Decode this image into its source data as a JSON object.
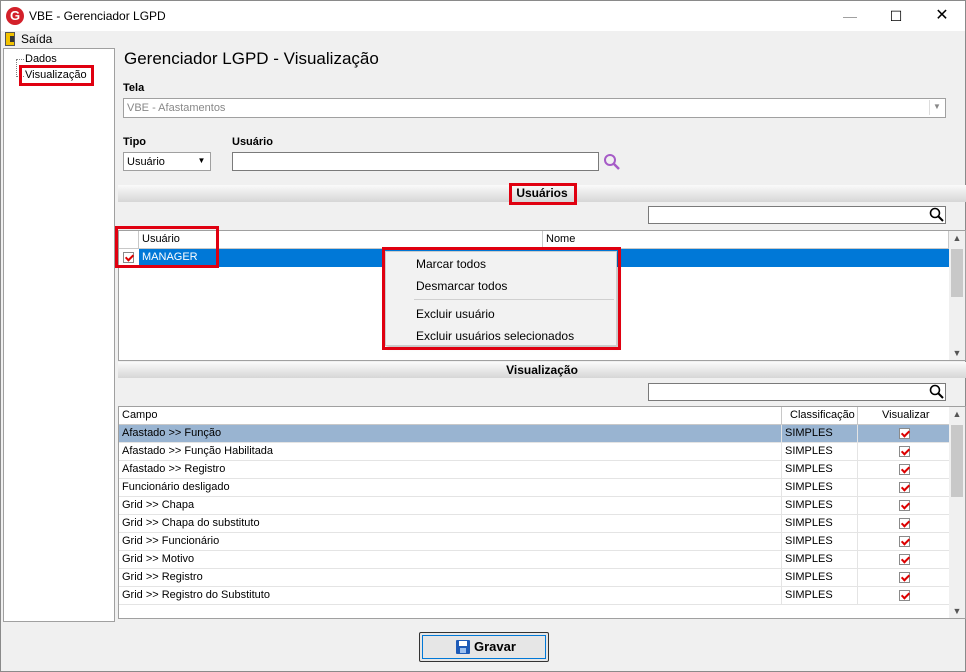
{
  "window": {
    "title": "VBE - Gerenciador LGPD",
    "icon_letter": "G",
    "minimize": "—",
    "maximize": "☐",
    "close": "✕"
  },
  "menu": {
    "exit_label": "Saída"
  },
  "tree": {
    "items": [
      {
        "label": "Dados"
      },
      {
        "label": "Visualização"
      }
    ]
  },
  "page": {
    "title": "Gerenciador LGPD - Visualização"
  },
  "form": {
    "tela_label": "Tela",
    "tela_value": "VBE - Afastamentos",
    "tipo_label": "Tipo",
    "tipo_value": "Usuário",
    "usuario_label": "Usuário",
    "usuario_value": ""
  },
  "users_section": {
    "title": "Usuários",
    "search_value": "",
    "columns": [
      "Usuário",
      "Nome"
    ],
    "rows": [
      {
        "usuario": "MANAGER",
        "nome": "",
        "checked": true
      }
    ]
  },
  "context_menu": {
    "items": [
      "Marcar todos",
      "Desmarcar todos",
      "Excluir usuário",
      "Excluir usuários selecionados"
    ]
  },
  "view_section": {
    "title": "Visualização",
    "search_value": "",
    "columns": [
      "Campo",
      "Classificação",
      "Visualizar"
    ],
    "rows": [
      {
        "campo": "Afastado >> Função",
        "classificacao": "SIMPLES",
        "visualizar": true
      },
      {
        "campo": "Afastado >> Função Habilitada",
        "classificacao": "SIMPLES",
        "visualizar": true
      },
      {
        "campo": "Afastado >> Registro",
        "classificacao": "SIMPLES",
        "visualizar": true
      },
      {
        "campo": "Funcionário desligado",
        "classificacao": "SIMPLES",
        "visualizar": true
      },
      {
        "campo": "Grid >> Chapa",
        "classificacao": "SIMPLES",
        "visualizar": true
      },
      {
        "campo": "Grid >> Chapa do substituto",
        "classificacao": "SIMPLES",
        "visualizar": true
      },
      {
        "campo": "Grid >> Funcionário",
        "classificacao": "SIMPLES",
        "visualizar": true
      },
      {
        "campo": "Grid >> Motivo",
        "classificacao": "SIMPLES",
        "visualizar": true
      },
      {
        "campo": "Grid >> Registro",
        "classificacao": "SIMPLES",
        "visualizar": true
      },
      {
        "campo": "Grid >> Registro do Substituto",
        "classificacao": "SIMPLES",
        "visualizar": true
      }
    ]
  },
  "footer": {
    "save_label": "Gravar"
  },
  "colors": {
    "selection": "#0078d7",
    "row_highlight": "#99b4d1",
    "annotation_red": "#e00010"
  }
}
